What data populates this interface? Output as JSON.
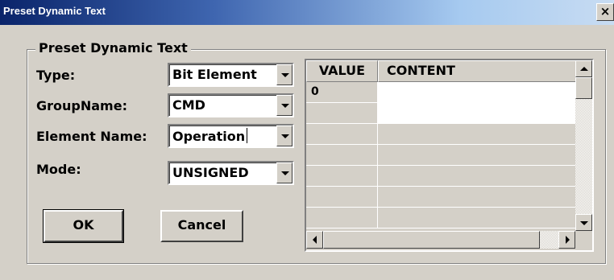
{
  "window": {
    "title": "Preset Dynamic Text",
    "close_glyph": "×"
  },
  "group": {
    "legend": "Preset Dynamic Text"
  },
  "form": {
    "type": {
      "label": "Type:",
      "value": "Bit Element"
    },
    "group_name": {
      "label": "GroupName:",
      "value": "CMD"
    },
    "element_name": {
      "label": "Element Name:",
      "value": "Operation"
    },
    "mode": {
      "label": "Mode:",
      "value": "UNSIGNED"
    }
  },
  "buttons": {
    "ok_label": "OK",
    "cancel_label": "Cancel"
  },
  "grid": {
    "columns": [
      "VALUE",
      "CONTENT"
    ],
    "rows": [
      {
        "value": "0",
        "content": ""
      },
      {
        "value": "",
        "content": ""
      },
      {
        "value": "",
        "content": ""
      },
      {
        "value": "",
        "content": ""
      },
      {
        "value": "",
        "content": ""
      },
      {
        "value": "",
        "content": ""
      },
      {
        "value": "",
        "content": ""
      }
    ]
  },
  "colors": {
    "window_face": "#d4d0c8",
    "title_start": "#0a246a",
    "title_end": "#c8dcf2",
    "input_bg": "#ffffff"
  },
  "icons": {
    "close": "close-icon",
    "dropdown": "chevron-down-icon",
    "scroll_up": "arrow-up-icon",
    "scroll_down": "arrow-down-icon",
    "scroll_left": "arrow-left-icon",
    "scroll_right": "arrow-right-icon"
  }
}
